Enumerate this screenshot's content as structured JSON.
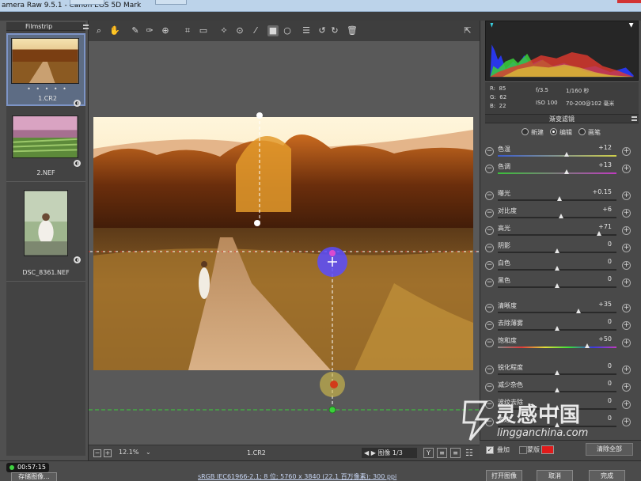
{
  "window": {
    "title": "amera Raw 9.5.1 - Canon EOS 5D Mark"
  },
  "filmstrip": {
    "header": "Filmstrip",
    "items": [
      {
        "label": "1.CR2",
        "rating": "• • • • •",
        "selected": true
      },
      {
        "label": "2.NEF",
        "selected": false
      },
      {
        "label": "DSC_8361.NEF",
        "selected": false
      }
    ]
  },
  "toolbar": {
    "tools": [
      "zoom-icon",
      "hand-icon",
      "white-balance-icon",
      "color-sampler-icon",
      "targeted-adjust-icon",
      "crop-icon",
      "straighten-icon",
      "spot-removal-icon",
      "red-eye-icon",
      "adjustment-brush-icon",
      "graduated-filter-icon",
      "radial-filter-icon",
      "presets-icon",
      "rotate-left-icon",
      "rotate-right-icon",
      "trash-icon",
      "fullscreen-icon"
    ]
  },
  "canvas_footer": {
    "zoom": "12.1%",
    "filename": "1.CR2",
    "image_nav": "图像 1/3",
    "view_buttons": [
      "Y",
      "≡",
      "≡"
    ]
  },
  "histogram": {
    "colors": {
      "red": "#e23a2e",
      "green": "#3ad03a",
      "blue": "#2a3aff",
      "cyan": "#3ad0e0",
      "yellow": "#e0e03a",
      "magenta": "#c04ad0"
    }
  },
  "camera_info": {
    "r": "85",
    "g": "62",
    "b": "22",
    "aperture": "f/3.5",
    "shutter": "1/160 秒",
    "iso": "ISO 100",
    "lens": "70-200@102 毫米"
  },
  "panel": {
    "title": "渐变滤镜",
    "modes": [
      {
        "label": "新建",
        "checked": false
      },
      {
        "label": "编辑",
        "checked": true
      },
      {
        "label": "画笔",
        "checked": false
      }
    ],
    "sliders": [
      {
        "name": "色温",
        "value": "+12",
        "pos": 0.58,
        "grad": "temp"
      },
      {
        "name": "色调",
        "value": "+13",
        "pos": 0.58,
        "grad": "tint"
      },
      {
        "name": "曝光",
        "value": "+0.15",
        "pos": 0.52,
        "grad": "gray"
      },
      {
        "name": "对比度",
        "value": "+6",
        "pos": 0.53,
        "grad": "gray"
      },
      {
        "name": "高光",
        "value": "+71",
        "pos": 0.85,
        "grad": "gray"
      },
      {
        "name": "阴影",
        "value": "0",
        "pos": 0.5,
        "grad": "gray"
      },
      {
        "name": "白色",
        "value": "0",
        "pos": 0.5,
        "grad": "gray"
      },
      {
        "name": "黑色",
        "value": "0",
        "pos": 0.5,
        "grad": "gray"
      },
      {
        "name": "清晰度",
        "value": "+35",
        "pos": 0.68,
        "grad": "gray"
      },
      {
        "name": "去除薄雾",
        "value": "0",
        "pos": 0.5,
        "grad": "gray"
      },
      {
        "name": "饱和度",
        "value": "+50",
        "pos": 0.75,
        "grad": "sat"
      },
      {
        "name": "锐化程度",
        "value": "0",
        "pos": 0.5,
        "grad": "gray"
      },
      {
        "name": "减少杂色",
        "value": "0",
        "pos": 0.5,
        "grad": "gray"
      },
      {
        "name": "波纹去除",
        "value": "0",
        "pos": 0.5,
        "grad": "gray"
      },
      {
        "name": "去边",
        "value": "0",
        "pos": 0.5,
        "grad": "gray"
      }
    ],
    "footer": {
      "overlay_label": "叠加",
      "mask_label": "蒙版",
      "mask_color": "#e01b1b",
      "clear_all": "清除全部"
    }
  },
  "bottom": {
    "timer": "00:57:15",
    "save": "存储图像...",
    "info": "sRGB IEC61966-2.1; 8 位; 5760 x 3840 (22.1 百万像素); 300 ppi",
    "open": "打开图像",
    "cancel": "取消",
    "done": "完成"
  },
  "watermark": {
    "main": "灵感中国",
    "sub": "lingganchina.com"
  }
}
